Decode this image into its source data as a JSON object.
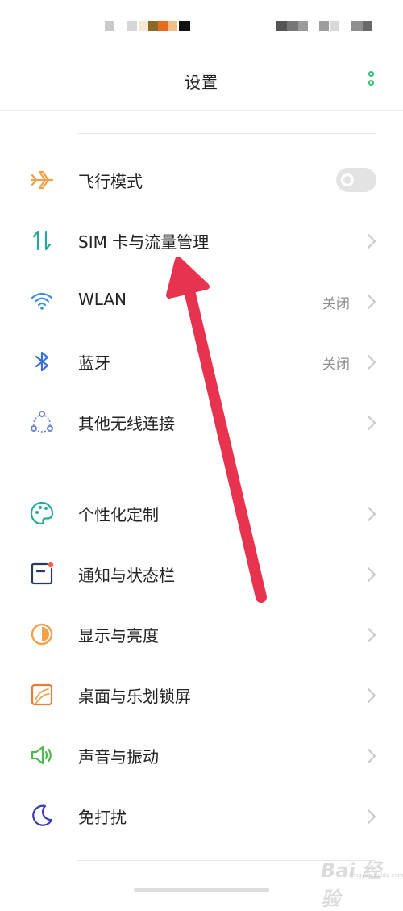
{
  "header": {
    "title": "设置",
    "more_icon": "more-vertical-icon"
  },
  "colors": {
    "accent_green": "#2fbf71",
    "arrow_red": "#e8334f"
  },
  "sections": [
    {
      "items": [
        {
          "id": "airplane",
          "label": "飞行模式",
          "icon": "airplane-icon",
          "type": "toggle",
          "toggle_on": false
        },
        {
          "id": "sim",
          "label": "SIM 卡与流量管理",
          "icon": "data-transfer-icon",
          "type": "link"
        },
        {
          "id": "wlan",
          "label": "WLAN",
          "icon": "wifi-icon",
          "type": "link",
          "value": "关闭"
        },
        {
          "id": "bluetooth",
          "label": "蓝牙",
          "icon": "bluetooth-icon",
          "type": "link",
          "value": "关闭"
        },
        {
          "id": "other-wireless",
          "label": "其他无线连接",
          "icon": "connection-icon",
          "type": "link"
        }
      ]
    },
    {
      "items": [
        {
          "id": "personalization",
          "label": "个性化定制",
          "icon": "palette-icon",
          "type": "link"
        },
        {
          "id": "notification",
          "label": "通知与状态栏",
          "icon": "notification-icon",
          "type": "link"
        },
        {
          "id": "display",
          "label": "显示与亮度",
          "icon": "brightness-icon",
          "type": "link"
        },
        {
          "id": "desktop",
          "label": "桌面与乐划锁屏",
          "icon": "wallpaper-icon",
          "type": "link"
        },
        {
          "id": "sound",
          "label": "声音与振动",
          "icon": "speaker-icon",
          "type": "link"
        },
        {
          "id": "dnd",
          "label": "免打扰",
          "icon": "moon-icon",
          "type": "link"
        }
      ]
    }
  ],
  "watermark": {
    "text": "Bai 经验",
    "sub": "jingyan.baidu.com"
  }
}
